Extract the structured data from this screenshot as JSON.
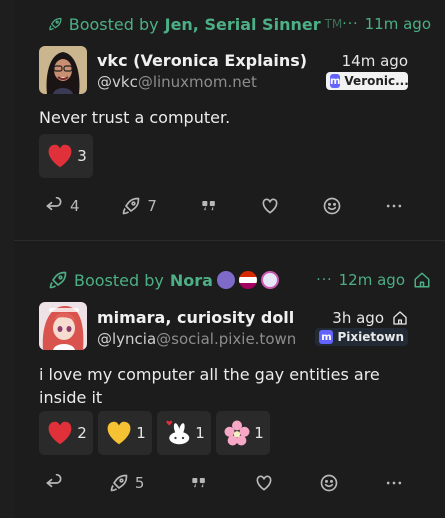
{
  "posts": [
    {
      "boost": {
        "prefix": "Boosted by",
        "name": "Jen, Serial Sinner",
        "tm": "TM",
        "dots": "···",
        "time": "11m ago"
      },
      "author": {
        "display_name": "vkc (Veronica Explains)",
        "user": "@vkc",
        "host": "@linuxmom.net"
      },
      "time": "14m ago",
      "instance": "Veronic...",
      "content": "Never trust a computer.",
      "reactions": [
        {
          "emoji": "red-heart",
          "count": "3"
        }
      ],
      "actions": {
        "reply_count": "4",
        "boost_count": "7"
      }
    },
    {
      "boost": {
        "prefix": "Boosted by",
        "name": "Nora",
        "dots": "···",
        "time": "12m ago"
      },
      "author": {
        "display_name": "mimara, curiosity doll",
        "user": "@lyncia",
        "host": "@social.pixie.town"
      },
      "time": "3h ago",
      "instance": "Pixietown",
      "content": "i love my computer all the gay entities are inside it",
      "reactions": [
        {
          "emoji": "red-heart",
          "count": "2"
        },
        {
          "emoji": "yellow-heart",
          "count": "1"
        },
        {
          "emoji": "bunny-heart",
          "count": "1"
        },
        {
          "emoji": "cherry-blossom",
          "count": "1"
        }
      ],
      "actions": {
        "boost_count": "5"
      }
    }
  ],
  "colors": {
    "accent_green": "#4caf85",
    "background": "#1c1c1c",
    "reaction_bg": "#2a2a2a"
  }
}
